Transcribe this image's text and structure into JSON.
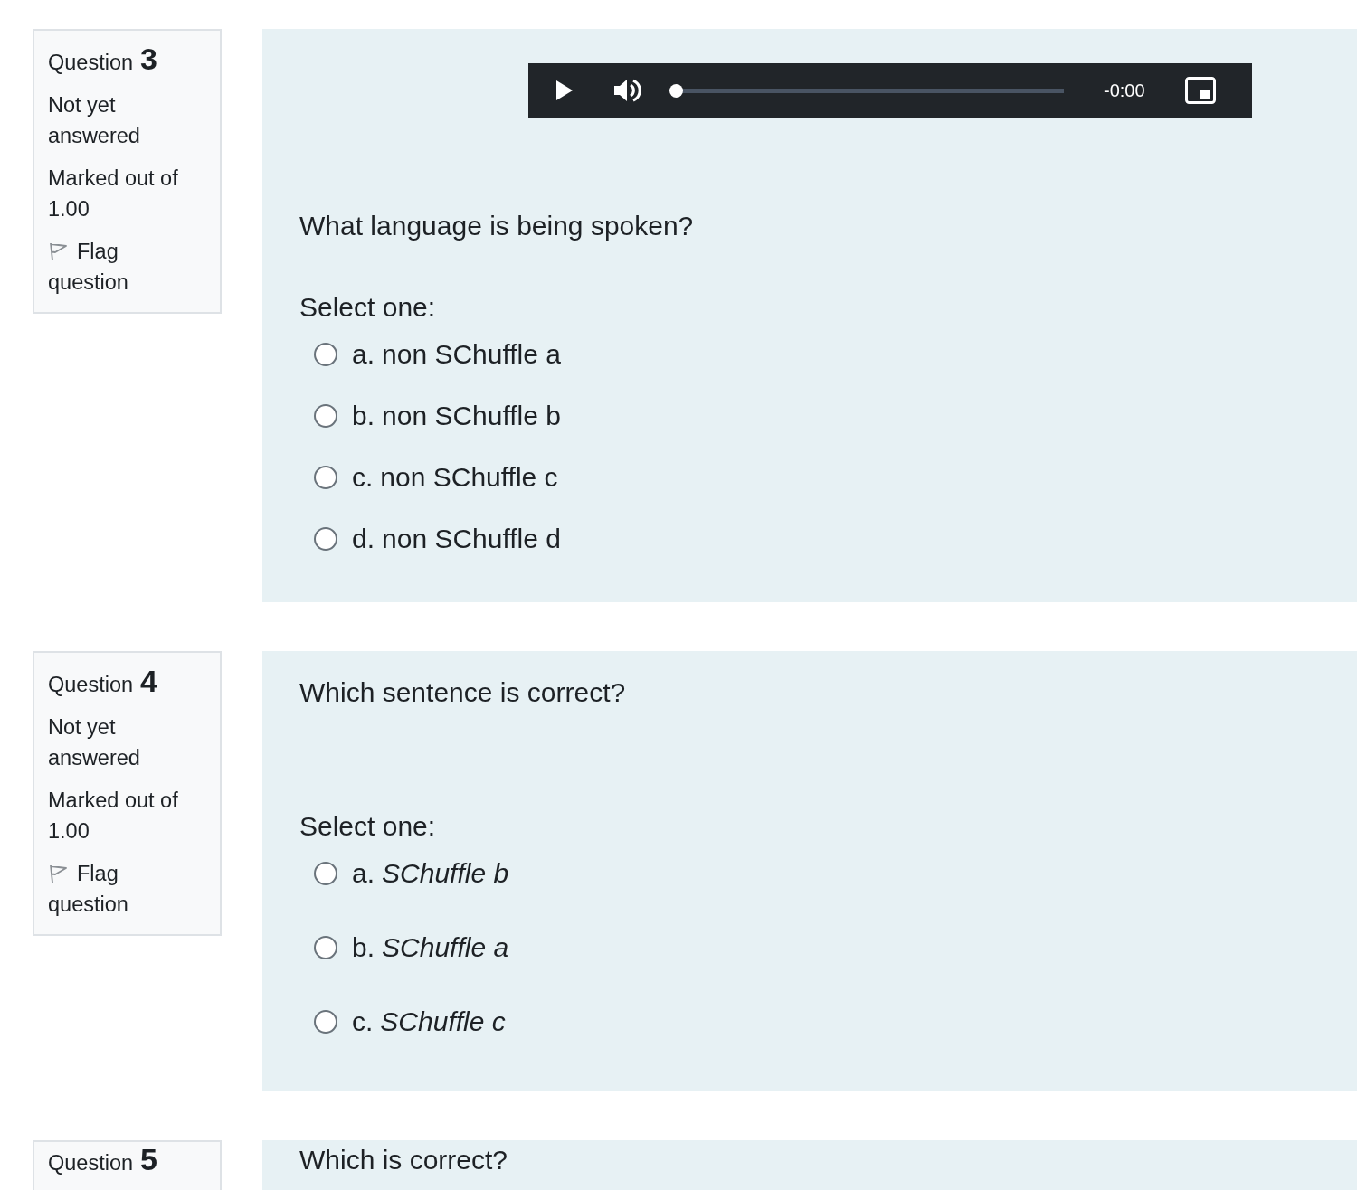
{
  "questions": [
    {
      "number": "3",
      "label": "Question",
      "status": "Not yet answered",
      "marks": "Marked out of 1.00",
      "flag": {
        "label": "Flag question",
        "flagged": false
      },
      "media": {
        "kind": "audio",
        "time": "-0:00",
        "level": 0
      },
      "prompt": "What language is being spoken?",
      "instruction": "Select one:",
      "italic_options": false,
      "options": [
        {
          "letter": "a.",
          "text": "non SChuffle a",
          "selected": false
        },
        {
          "letter": "b.",
          "text": "non SChuffle b",
          "selected": false
        },
        {
          "letter": "c.",
          "text": "non SChuffle c",
          "selected": false
        },
        {
          "letter": "d.",
          "text": "non SChuffle d",
          "selected": false
        }
      ]
    },
    {
      "number": "4",
      "label": "Question",
      "status": "Not yet answered",
      "marks": "Marked out of 1.00",
      "flag": {
        "label": "Flag question",
        "flagged": false
      },
      "prompt": "Which sentence is correct?",
      "instruction": "Select one:",
      "italic_options": true,
      "options": [
        {
          "letter": "a.",
          "text": "SChuffle b",
          "selected": false
        },
        {
          "letter": "b.",
          "text": "SChuffle a",
          "selected": false
        },
        {
          "letter": "c.",
          "text": "SChuffle c",
          "selected": false
        }
      ]
    },
    {
      "number": "5",
      "label": "Question",
      "prompt": "Which is correct?"
    }
  ]
}
